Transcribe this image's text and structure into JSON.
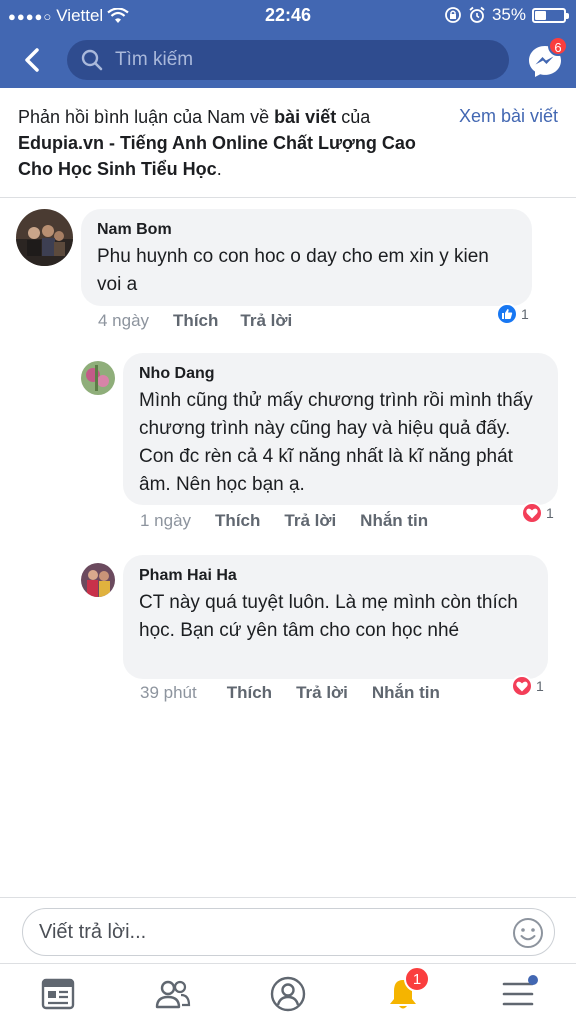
{
  "status_bar": {
    "carrier": "Viettel",
    "time": "22:46",
    "battery": "35%",
    "battery_level": 0.35
  },
  "nav": {
    "search_placeholder": "Tìm kiếm",
    "messenger_badge": "6"
  },
  "context": {
    "part1": "Phản hồi bình luận của Nam về ",
    "bold1": "bài viết",
    "part2": " của ",
    "bold2": "Edupia.vn - Tiếng Anh Online Chất Lượng Cao Cho Học Sinh Tiểu Học",
    "part3": ".",
    "view_post": "Xem bài viết"
  },
  "comments": [
    {
      "author": "Nam Bom",
      "text": "Phu huynh co con hoc o day cho em xin y kien voi a",
      "time": "4 ngày",
      "like": "Thích",
      "reply": "Trả lời",
      "reaction_type": "like",
      "reaction_count": "1"
    },
    {
      "author": "Nho Dang",
      "text": "Mình cũng thử mấy chương trình rồi mình thấy chương trình này cũng hay và hiệu quả đấy. Con đc rèn cả 4 kĩ năng nhất là kĩ năng phát âm. Nên học bạn ạ.",
      "time": "1 ngày",
      "like": "Thích",
      "reply": "Trả lời",
      "message": "Nhắn tin",
      "reaction_type": "love",
      "reaction_count": "1"
    },
    {
      "author": "Pham Hai Ha",
      "text": "CT này quá tuyệt luôn. Là mẹ mình còn thích học. Bạn cứ yên tâm cho con học nhé",
      "time": "39 phút",
      "like": "Thích",
      "reply": "Trả lời",
      "message": "Nhắn tin",
      "reaction_type": "love",
      "reaction_count": "1"
    }
  ],
  "reply_box": {
    "placeholder": "Viết trả lời..."
  },
  "tabbar": {
    "notifications_badge": "1",
    "icons": [
      "news-feed-icon",
      "friends-icon",
      "profile-icon",
      "bell-icon",
      "menu-icon"
    ]
  },
  "colors": {
    "brand": "#4267b2",
    "bubble": "#f2f3f5",
    "badge": "#fa3e3e",
    "love": "#f33e58"
  }
}
